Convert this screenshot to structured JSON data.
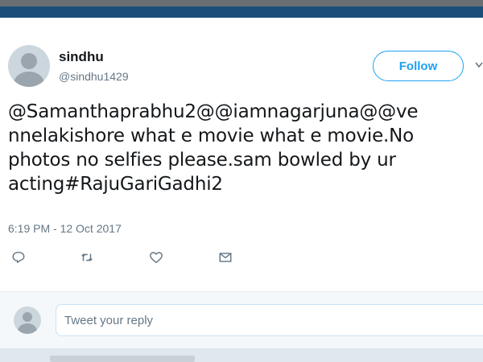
{
  "tweet": {
    "author_name": "sindhu",
    "author_handle": "@sindhu1429",
    "follow_label": "Follow",
    "text_lines": [
      "@Samanthaprabhu2@@iamnagarjuna@@ve",
      "nnelakishore what e movie what e movie.No",
      "photos no selfies please.sam bowled by ur",
      "acting#RajuGariGadhi2"
    ],
    "timestamp": "6:19 PM - 12 Oct 2017"
  },
  "actions": {
    "reply_icon": "reply-icon",
    "retweet_icon": "retweet-icon",
    "like_icon": "heart-icon",
    "dm_icon": "envelope-icon"
  },
  "reply": {
    "placeholder": "Tweet your reply"
  },
  "colors": {
    "brand_blue": "#1da1f2",
    "header_blue": "#1b4f7a",
    "muted": "#657786"
  }
}
